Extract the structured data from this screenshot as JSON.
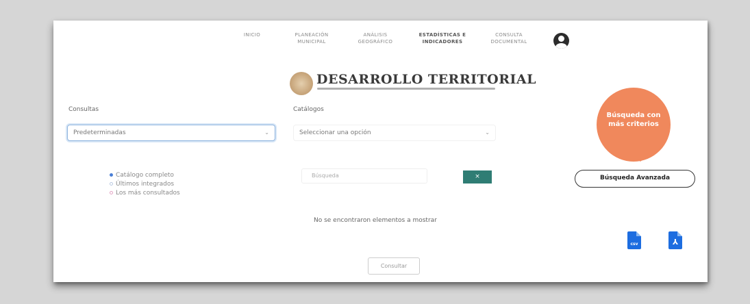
{
  "nav": {
    "items": [
      {
        "label": "INICIO"
      },
      {
        "label": "PLANEACIÓN MUNICIPAL"
      },
      {
        "label": "ANÁLISIS GEOGRÁFICO"
      },
      {
        "label": "ESTADÍSTICAS E INDICADORES",
        "active": true
      },
      {
        "label": "CONSULTA DOCUMENTAL"
      }
    ]
  },
  "header": {
    "title": "DESARROLLO TERRITORIAL"
  },
  "consultas": {
    "label": "Consultas",
    "selected": "Predeterminadas"
  },
  "catalogos": {
    "label": "Catálogos",
    "selected": "Seleccionar una opción"
  },
  "radios": [
    {
      "label": "Catálogo completo",
      "checked": true
    },
    {
      "label": "Últimos integrados",
      "checked": false
    },
    {
      "label": "Los más consultados",
      "checked": false
    }
  ],
  "search": {
    "placeholder": "Búsqueda",
    "button_label": "×"
  },
  "results": {
    "empty_text": "No se encontraron elementos a mostrar"
  },
  "consultar_button": "Consultar",
  "callout": {
    "line1": "Búsqueda con",
    "line2": "más criterios"
  },
  "advanced_button": "Búsqueda Avanzada",
  "exports": {
    "csv_label": "csv"
  },
  "colors": {
    "accent": "#f0885c",
    "search_button": "#2f7d74",
    "file_icon": "#1d6de0"
  }
}
